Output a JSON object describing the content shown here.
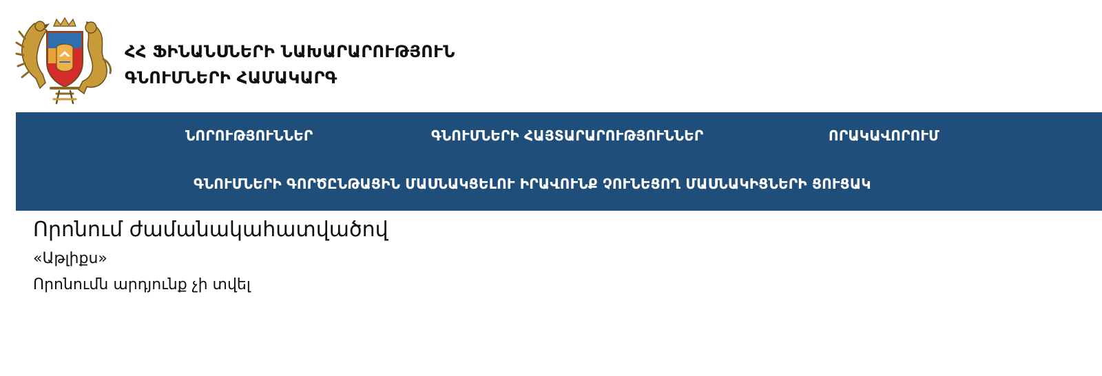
{
  "header": {
    "org_line1": "ՀՀ ՖԻՆԱՆՍՆԵՐԻ ՆԱԽԱՐԱՐՈՒԹՅՈՒՆ",
    "org_line2": "ԳՆՈՒՄՆԵՐԻ ՀԱՄԱԿԱՐԳ",
    "emblem_icon": "armenia-coat-of-arms-icon"
  },
  "nav": {
    "background_color": "#1e4e79",
    "items": [
      {
        "label": "ՆՈՐՈՒԹՅՈՒՆՆԵՐ"
      },
      {
        "label": "ԳՆՈՒՄՆԵՐԻ ՀԱՅՏԱՐԱՐՈՒԹՅՈՒՆՆԵՐ"
      },
      {
        "label": "ՈՐԱԿԱՎՈՐՈՒՄ"
      },
      {
        "label": "ԳՆՈՒՄՆԵՐԻ ԳՈՐԾԸՆԹԱՑԻՆ ՄԱՍՆԱԿՑԵԼՈՒ ԻՐԱՎՈՒՆՔ ՉՈՒՆԵՑՈՂ ՄԱՍՆԱԿԻՑՆԵՐԻ ՑՈՒՑԱԿ"
      }
    ]
  },
  "main": {
    "title": "Որոնում ժամանակահատվածով",
    "query": "«Աթլիքս»",
    "result": "Որոնումն արդյունք չի տվել"
  }
}
